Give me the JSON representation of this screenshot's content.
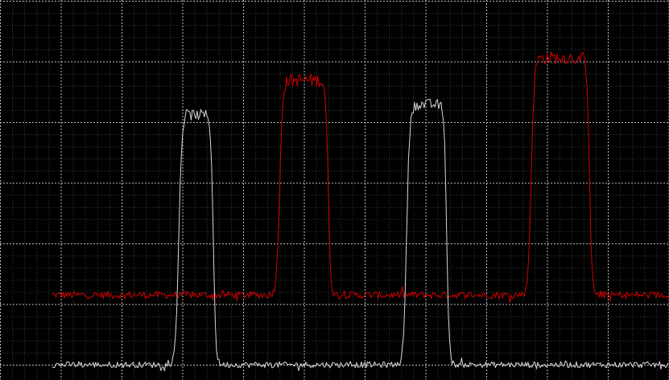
{
  "chart_data": {
    "type": "line",
    "title": "",
    "xlabel": "",
    "ylabel": "",
    "xlim": [
      0,
      11
    ],
    "ylim": [
      -0.25,
      6
    ],
    "grid": true,
    "major_divisions": {
      "x": 11,
      "y": 6
    },
    "minor_per_division": 5,
    "grid_colors": {
      "major": "#bdbdbd",
      "minor": "#3a3a3a",
      "background": "#000000"
    },
    "series": [
      {
        "color": "#d40000",
        "x_start": 0.86,
        "x_end": 11,
        "baseline": 1.15,
        "noise": 0.06,
        "pulses": [
          {
            "start": 4.6,
            "end": 5.4,
            "level": 4.69
          },
          {
            "start": 8.74,
            "end": 9.7,
            "level": 5.06
          }
        ]
      },
      {
        "color": "#d8d8d8",
        "x_start": 0.86,
        "x_end": 11,
        "baseline": 0.0,
        "noise": 0.05,
        "pulses": [
          {
            "start": 2.94,
            "end": 3.51,
            "level": 4.12
          },
          {
            "start": 6.69,
            "end": 7.35,
            "level": 4.29
          }
        ]
      }
    ]
  }
}
